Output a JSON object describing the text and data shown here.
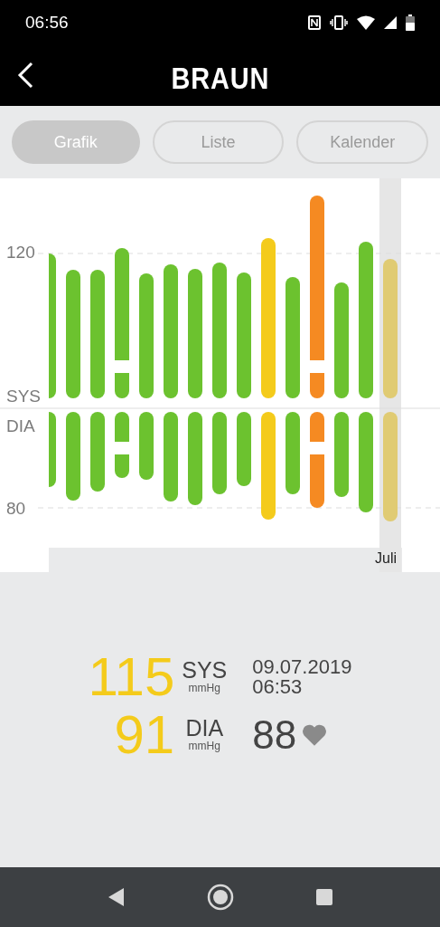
{
  "status_bar": {
    "time": "06:56"
  },
  "header": {
    "logo": "BRAUN"
  },
  "tabs": [
    {
      "label": "Grafik",
      "selected": true
    },
    {
      "label": "Liste",
      "selected": false
    },
    {
      "label": "Kalender",
      "selected": false
    }
  ],
  "chart": {
    "month": "Juli",
    "bars": [
      {
        "color": "#6cc22f",
        "selected": false,
        "marked": false
      },
      {
        "color": "#6cc22f",
        "selected": false,
        "marked": false
      },
      {
        "color": "#6cc22f",
        "selected": false,
        "marked": false
      },
      {
        "color": "#6cc22f",
        "selected": false,
        "marked": true
      },
      {
        "color": "#6cc22f",
        "selected": false,
        "marked": false
      },
      {
        "color": "#6cc22f",
        "selected": false,
        "marked": false
      },
      {
        "color": "#6cc22f",
        "selected": false,
        "marked": false
      },
      {
        "color": "#6cc22f",
        "selected": false,
        "marked": false
      },
      {
        "color": "#6cc22f",
        "selected": false,
        "marked": false
      },
      {
        "color": "#f4cb1b",
        "selected": false,
        "marked": false
      },
      {
        "color": "#6cc22f",
        "selected": false,
        "marked": false
      },
      {
        "color": "#f58a22",
        "selected": false,
        "marked": true
      },
      {
        "color": "#6cc22f",
        "selected": false,
        "marked": false
      },
      {
        "color": "#6cc22f",
        "selected": false,
        "marked": false
      },
      {
        "color": "#e0cb73",
        "selected": true,
        "marked": false
      }
    ],
    "axis_labels": [
      "120",
      "SYS",
      "DIA",
      "80"
    ]
  },
  "reading": {
    "sys": "115",
    "sys_label": "SYS",
    "sys_unit": "mmHg",
    "date": "09.07.2019",
    "time": "06:53",
    "dia": "91",
    "dia_label": "DIA",
    "dia_unit": "mmHg",
    "pulse": "88"
  }
}
